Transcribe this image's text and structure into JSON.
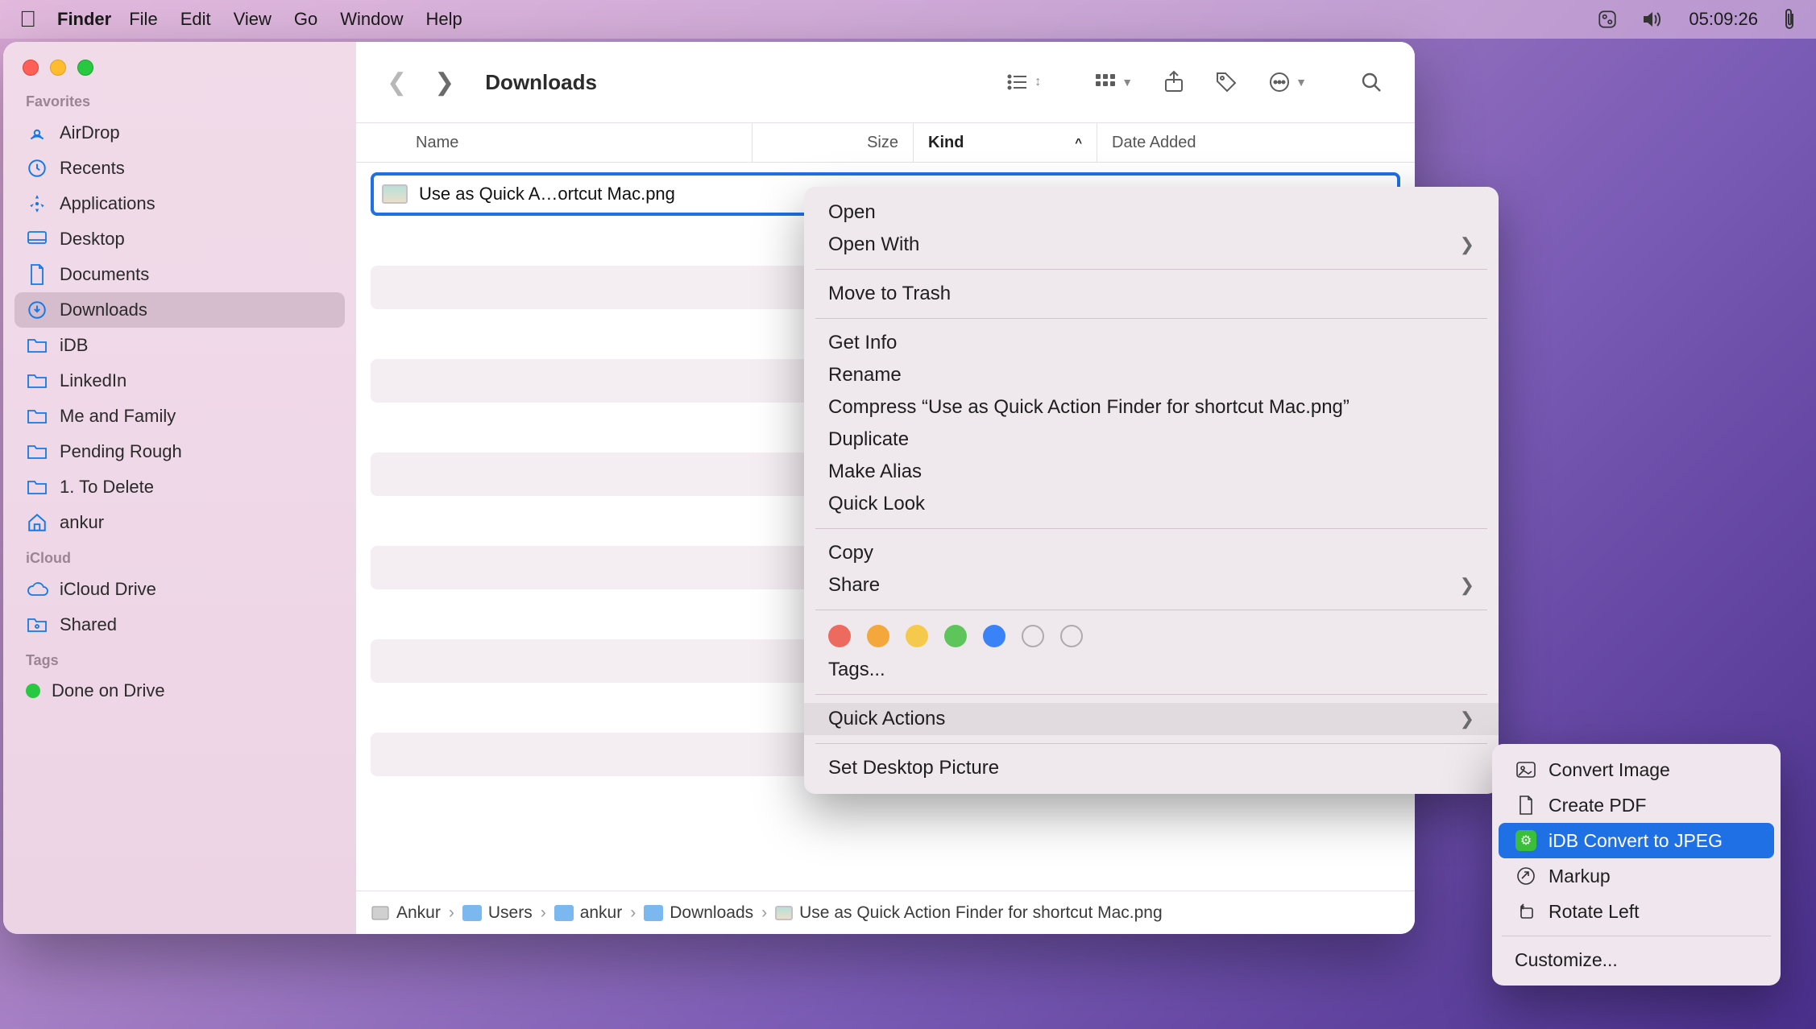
{
  "menubar": {
    "app": "Finder",
    "items": [
      "File",
      "Edit",
      "View",
      "Go",
      "Window",
      "Help"
    ],
    "clock": "05:09:26"
  },
  "window": {
    "title": "Downloads"
  },
  "sidebar": {
    "sections": {
      "favorites": "Favorites",
      "icloud": "iCloud",
      "tags": "Tags"
    },
    "favorites": [
      {
        "label": "AirDrop",
        "icon": "airdrop"
      },
      {
        "label": "Recents",
        "icon": "clock"
      },
      {
        "label": "Applications",
        "icon": "apps"
      },
      {
        "label": "Desktop",
        "icon": "desktop"
      },
      {
        "label": "Documents",
        "icon": "doc"
      },
      {
        "label": "Downloads",
        "icon": "download",
        "active": true
      },
      {
        "label": "iDB",
        "icon": "folder"
      },
      {
        "label": "LinkedIn",
        "icon": "folder"
      },
      {
        "label": "Me and Family",
        "icon": "folder"
      },
      {
        "label": "Pending Rough",
        "icon": "folder"
      },
      {
        "label": "1. To Delete",
        "icon": "folder"
      },
      {
        "label": "ankur",
        "icon": "home"
      }
    ],
    "icloud": [
      {
        "label": "iCloud Drive",
        "icon": "cloud"
      },
      {
        "label": "Shared",
        "icon": "shared"
      }
    ],
    "tags": [
      {
        "label": "Done on Drive",
        "color": "#28c840"
      }
    ]
  },
  "columns": {
    "name": "Name",
    "size": "Size",
    "kind": "Kind",
    "date": "Date Added"
  },
  "file": {
    "name": "Use as Quick A…ortcut Mac.png"
  },
  "pathbar": {
    "segments": [
      "Ankur",
      "Users",
      "ankur",
      "Downloads",
      "Use as Quick Action Finder for shortcut Mac.png"
    ]
  },
  "context_menu": {
    "open": "Open",
    "open_with": "Open With",
    "trash": "Move to Trash",
    "get_info": "Get Info",
    "rename": "Rename",
    "compress": "Compress “Use as Quick Action Finder for shortcut Mac.png”",
    "duplicate": "Duplicate",
    "make_alias": "Make Alias",
    "quick_look": "Quick Look",
    "copy": "Copy",
    "share": "Share",
    "tags": "Tags...",
    "quick_actions": "Quick Actions",
    "set_desktop": "Set Desktop Picture",
    "tag_colors": [
      "#ec6a5e",
      "#f4a83b",
      "#f5c94c",
      "#5dc559",
      "#3a82f7",
      "outline",
      "outline"
    ]
  },
  "submenu": {
    "items": [
      {
        "label": "Convert Image",
        "icon": "convert"
      },
      {
        "label": "Create PDF",
        "icon": "doc"
      },
      {
        "label": "iDB Convert to JPEG",
        "icon": "green",
        "selected": true
      },
      {
        "label": "Markup",
        "icon": "markup"
      },
      {
        "label": "Rotate Left",
        "icon": "rotate"
      }
    ],
    "customize": "Customize..."
  }
}
